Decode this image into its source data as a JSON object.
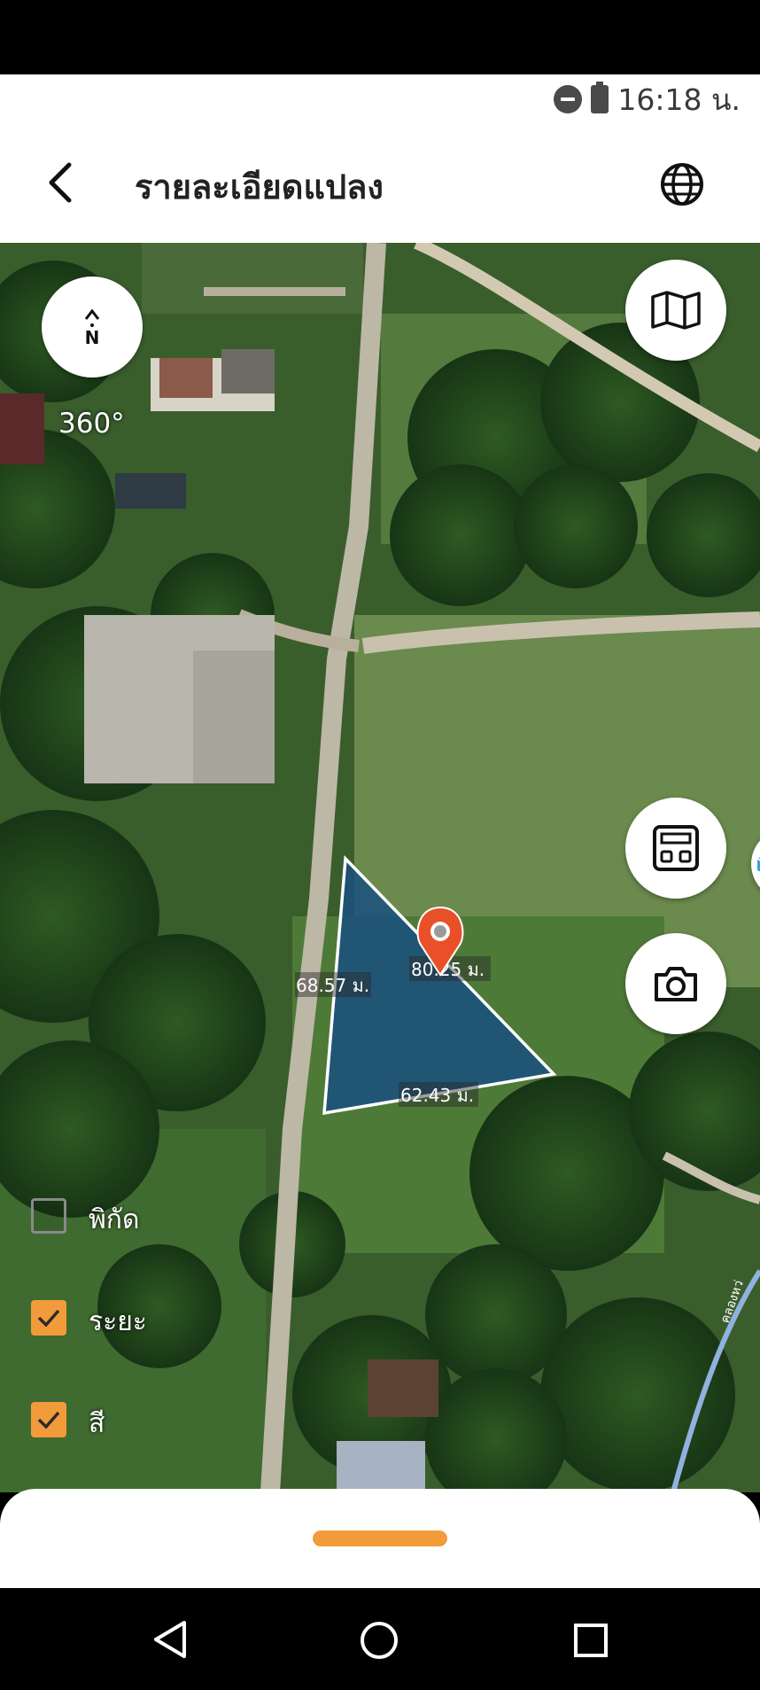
{
  "status_bar": {
    "time": "16:18 น."
  },
  "header": {
    "title": "รายละเอียดแปลง"
  },
  "compass": {
    "north_label": "N",
    "heading": "360°"
  },
  "plot": {
    "distances": [
      {
        "label": "68.57 ม."
      },
      {
        "label": "80.25 ม."
      },
      {
        "label": "62.43 ม."
      }
    ],
    "fill_color": "#1a4f7f",
    "marker_color": "#e9502a"
  },
  "toggles": [
    {
      "label": "พิกัด",
      "checked": false
    },
    {
      "label": "ระยะ",
      "checked": true
    },
    {
      "label": "สี",
      "checked": true
    }
  ],
  "stream_label": "คลองหว่",
  "colors": {
    "accent": "#f29b3a"
  }
}
